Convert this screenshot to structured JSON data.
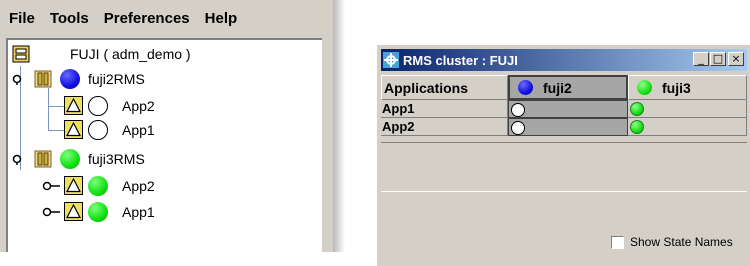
{
  "menubar": {
    "items": [
      "File",
      "Tools",
      "Preferences",
      "Help"
    ]
  },
  "tree": {
    "root": {
      "label": "FUJI ( adm_demo )"
    },
    "nodes": [
      {
        "label": "fuji2RMS",
        "state_color": "#1010e0",
        "apps": [
          {
            "label": "App2",
            "state": "offline"
          },
          {
            "label": "App1",
            "state": "offline"
          }
        ]
      },
      {
        "label": "fuji3RMS",
        "state_color": "#10e010",
        "apps": [
          {
            "label": "App2",
            "state": "online"
          },
          {
            "label": "App1",
            "state": "online"
          }
        ]
      }
    ]
  },
  "cluster_window": {
    "title": "RMS cluster : FUJI",
    "columns": [
      {
        "label": "Applications"
      },
      {
        "label": "fuji2",
        "state_color": "#1010e0"
      },
      {
        "label": "fuji3",
        "state_color": "#10e010"
      }
    ],
    "rows": [
      {
        "label": "App1",
        "fuji2": "offline",
        "fuji3": "online"
      },
      {
        "label": "App2",
        "fuji2": "offline",
        "fuji3": "online"
      }
    ],
    "show_state_names": {
      "label": "Show State Names",
      "checked": false
    }
  },
  "colors": {
    "online": "#10e010",
    "offline": "#ffffff",
    "node_blue": "#1010e0",
    "title_bar": "#0a246a"
  },
  "icons": [
    "cluster-icon",
    "node-icon",
    "warning-triangle-icon",
    "expand-collapse-icon",
    "app-icon",
    "minimize-icon",
    "maximize-icon",
    "close-icon"
  ]
}
